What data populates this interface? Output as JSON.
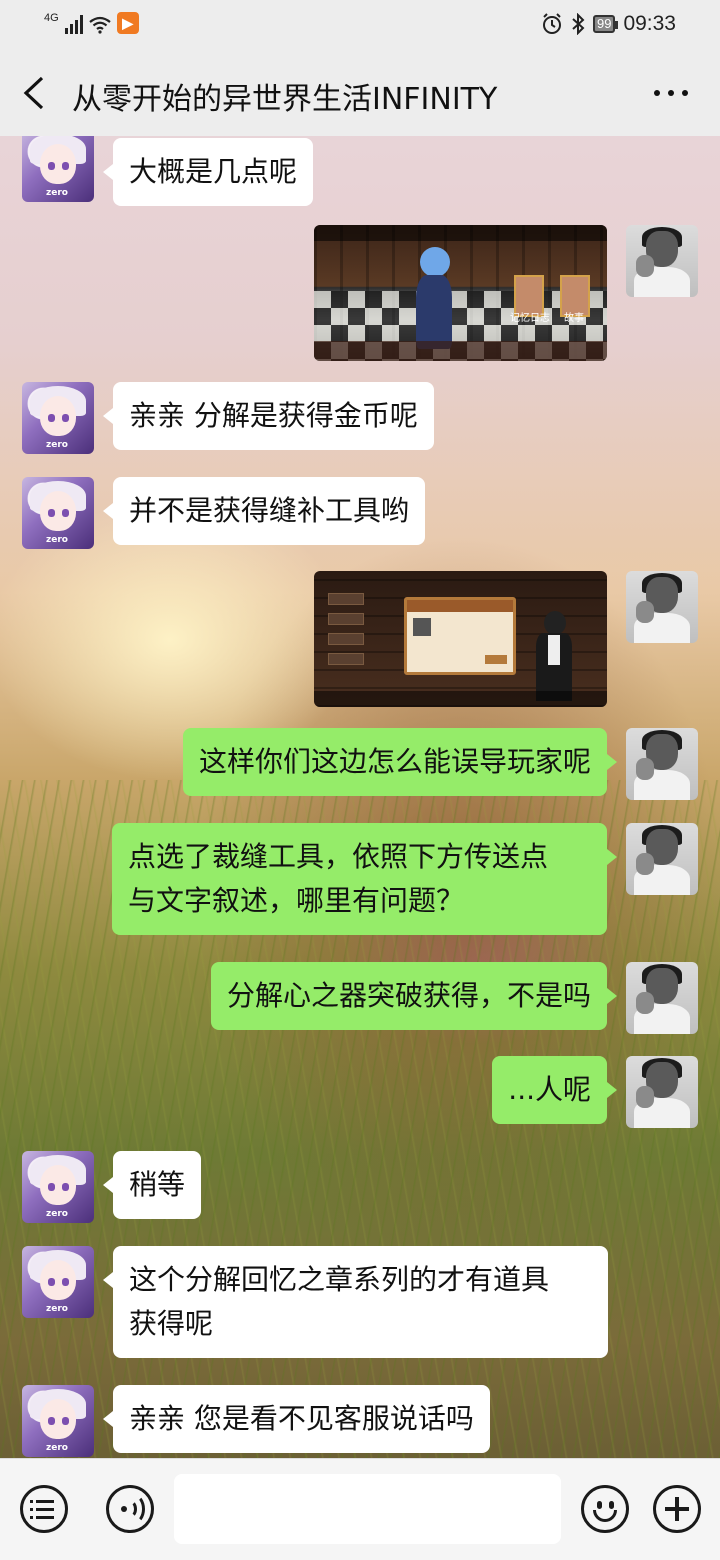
{
  "status_bar": {
    "network": "4G",
    "app_badge": "▶",
    "battery": "99",
    "time": "09:33"
  },
  "header": {
    "back_label": "<",
    "title": "从零开始的异世界生活INFINITY",
    "more_label": "..."
  },
  "messages": [
    {
      "side": "left",
      "type": "text",
      "text": "大概是几点呢"
    },
    {
      "side": "right",
      "type": "image",
      "image_labels": [
        "记忆日志",
        "故事"
      ]
    },
    {
      "side": "left",
      "type": "text",
      "text": "亲亲 分解是获得金币呢"
    },
    {
      "side": "left",
      "type": "text",
      "text": "并不是获得缝补工具哟"
    },
    {
      "side": "right",
      "type": "image",
      "image_labels": []
    },
    {
      "side": "right",
      "type": "text",
      "text": "这样你们这边怎么能误导玩家呢"
    },
    {
      "side": "right",
      "type": "text",
      "text_lines": [
        "点选了裁缝工具，依照下方传送点",
        "与文字叙述，哪里有问题？"
      ]
    },
    {
      "side": "right",
      "type": "text",
      "text": "分解心之器突破获得，不是吗"
    },
    {
      "side": "right",
      "type": "text",
      "text": "...人呢"
    },
    {
      "side": "left",
      "type": "text",
      "text": "稍等"
    },
    {
      "side": "left",
      "type": "text",
      "text_lines": [
        "这个分解回忆之章系列的才有道具",
        "获得呢"
      ]
    },
    {
      "side": "left",
      "type": "text",
      "text": "亲亲 您是看不见客服说话吗"
    }
  ],
  "input_bar": {
    "menu_icon": "menu-icon",
    "voice_icon": "voice-icon",
    "emoji_icon": "emoji-icon",
    "plus_icon": "plus-icon",
    "input_value": ""
  },
  "colors": {
    "outgoing_bubble": "#95ec69",
    "incoming_bubble": "#ffffff",
    "header_bg": "#ededed"
  }
}
